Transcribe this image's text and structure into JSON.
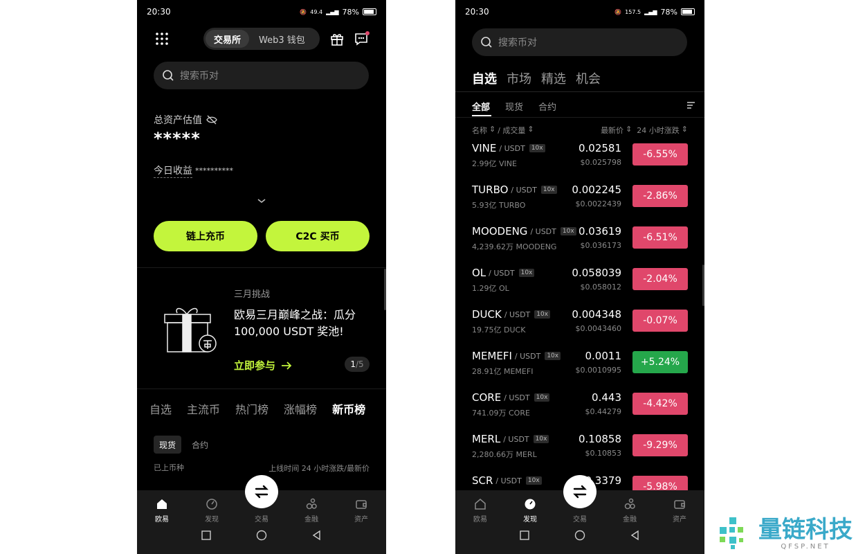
{
  "status": {
    "left_time": "20:30",
    "right_time": "20:30",
    "battery": "78%",
    "left_net_speed": "49.4",
    "right_net_speed": "157.5"
  },
  "left": {
    "seg_exchange": "交易所",
    "seg_web3": "Web3 钱包",
    "search_placeholder": "搜索币对",
    "asset_label": "总资产估值",
    "asset_value": "*****",
    "today_label": "今日收益",
    "today_value": "**********",
    "btn_deposit": "链上充币",
    "btn_c2c": "C2C 买币",
    "promo_tag": "三月挑战",
    "promo_title_1": "欧易三月巅峰之战：瓜分",
    "promo_title_2": "100,000 USDT 奖池!",
    "promo_cta": "立即参与",
    "promo_page_current": "1",
    "promo_page_total": "/5",
    "tabs": [
      "自选",
      "主流币",
      "热门榜",
      "涨幅榜",
      "新币榜"
    ],
    "subtab_spot": "现货",
    "subtab_contract": "合约",
    "list_label": "已上币种",
    "list_cols": "上线时间 24 小时涨跌/最新价"
  },
  "right": {
    "search_placeholder": "搜索币对",
    "main_tabs": [
      "自选",
      "市场",
      "精选",
      "机会"
    ],
    "sub_tabs": [
      "全部",
      "现货",
      "合约"
    ],
    "col_name": "名称",
    "col_vol": "/ 成交量",
    "col_price": "最新价",
    "col_change": "24 小时涨跌",
    "rows": [
      {
        "base": "VINE",
        "quote": "/ USDT",
        "lev": "10x",
        "vol": "2.99亿 VINE",
        "price": "0.02581",
        "fiat": "$0.025798",
        "chg": "-6.55%",
        "dir": "down"
      },
      {
        "base": "TURBO",
        "quote": "/ USDT",
        "lev": "10x",
        "vol": "5.93亿 TURBO",
        "price": "0.002245",
        "fiat": "$0.0022439",
        "chg": "-2.86%",
        "dir": "down"
      },
      {
        "base": "MOODENG",
        "quote": "/ USDT",
        "lev": "10x",
        "vol": "4,239.62万 MOODENG",
        "price": "0.03619",
        "fiat": "$0.036173",
        "chg": "-6.51%",
        "dir": "down"
      },
      {
        "base": "OL",
        "quote": "/ USDT",
        "lev": "10x",
        "vol": "1.29亿 OL",
        "price": "0.058039",
        "fiat": "$0.058012",
        "chg": "-2.04%",
        "dir": "down"
      },
      {
        "base": "DUCK",
        "quote": "/ USDT",
        "lev": "10x",
        "vol": "19.75亿 DUCK",
        "price": "0.004348",
        "fiat": "$0.0043460",
        "chg": "-0.07%",
        "dir": "down"
      },
      {
        "base": "MEMEFI",
        "quote": "/ USDT",
        "lev": "10x",
        "vol": "28.91亿 MEMEFI",
        "price": "0.0011",
        "fiat": "$0.0010995",
        "chg": "+5.24%",
        "dir": "up"
      },
      {
        "base": "CORE",
        "quote": "/ USDT",
        "lev": "10x",
        "vol": "741.09万 CORE",
        "price": "0.443",
        "fiat": "$0.44279",
        "chg": "-4.42%",
        "dir": "down"
      },
      {
        "base": "MERL",
        "quote": "/ USDT",
        "lev": "10x",
        "vol": "2,280.66万 MERL",
        "price": "0.10858",
        "fiat": "$0.10853",
        "chg": "-9.29%",
        "dir": "down"
      },
      {
        "base": "SCR",
        "quote": "/ USDT",
        "lev": "10x",
        "vol": "",
        "price": "0.3379",
        "fiat": "",
        "chg": "-5.98%",
        "dir": "down"
      }
    ]
  },
  "nav": {
    "items": [
      "欧易",
      "发现",
      "交易",
      "金融",
      "资产"
    ]
  },
  "watermark": {
    "cn": "量链科技",
    "en": "QFSP.NET"
  },
  "colors": {
    "accent_lime": "#c3f53c",
    "down_red": "#e0476b",
    "up_green": "#25a74b"
  }
}
